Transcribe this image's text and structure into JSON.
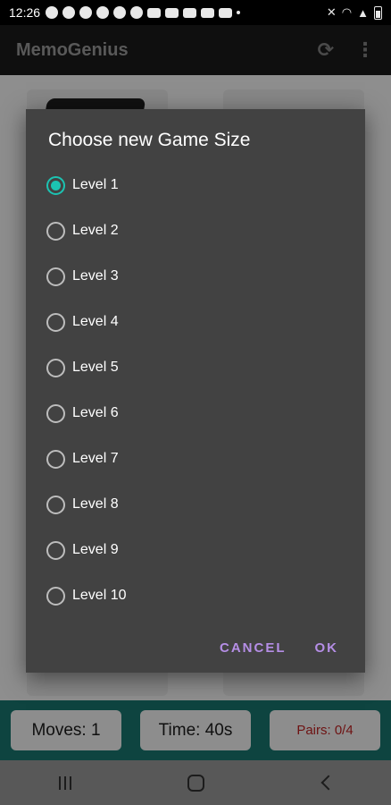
{
  "status_bar": {
    "time": "12:26",
    "notification_icons": [
      "facebook-icon",
      "facebook-icon",
      "facebook-icon",
      "facebook-icon",
      "tiktok-icon",
      "tiktok-icon",
      "youtube-icon",
      "youtube-icon",
      "youtube-icon",
      "youtube-icon",
      "mail-icon",
      "dot-icon"
    ],
    "system_icons": [
      "mute-icon",
      "wifi-icon",
      "signal-icon",
      "battery-icon"
    ]
  },
  "app_bar": {
    "title": "MemoGenius",
    "refresh_icon": "⟳",
    "menu_icon": "⋮"
  },
  "dialog": {
    "title": "Choose new Game Size",
    "selected_index": 0,
    "options": [
      "Level 1",
      "Level 2",
      "Level 3",
      "Level 4",
      "Level 5",
      "Level 6",
      "Level 7",
      "Level 8",
      "Level 9",
      "Level 10"
    ],
    "cancel_label": "CANCEL",
    "ok_label": "OK"
  },
  "stats": {
    "moves": "Moves: 1",
    "time": "Time: 40s",
    "pairs": "Pairs: 0/4"
  },
  "colors": {
    "accent_radio": "#1cc3b2",
    "dialog_button": "#b58ee6",
    "dialog_background": "#424242",
    "stats_bar": "#0e4440"
  }
}
